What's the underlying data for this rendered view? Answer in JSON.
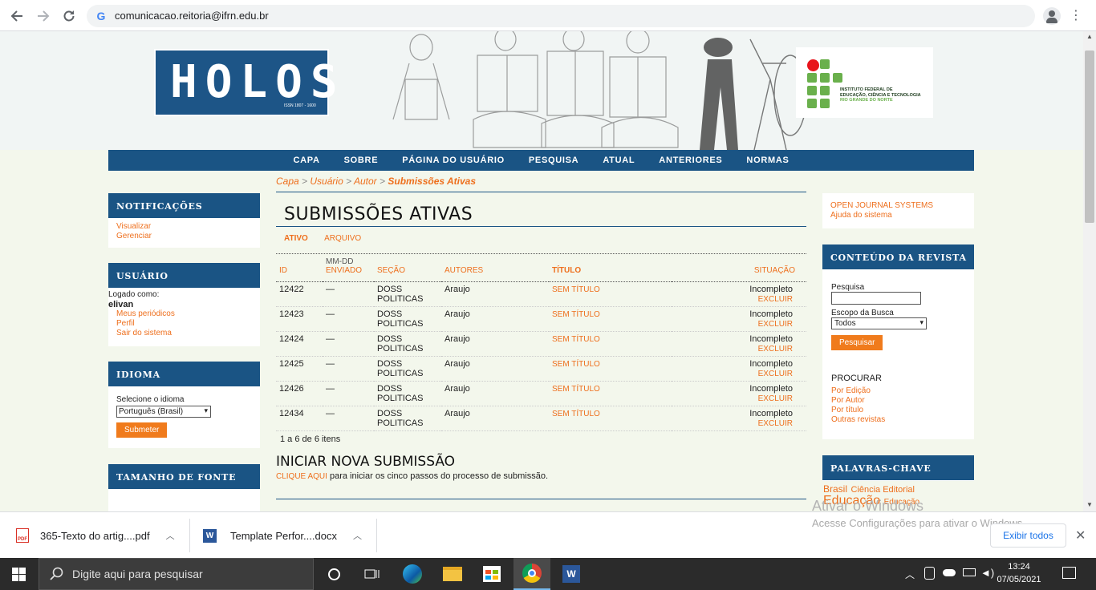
{
  "browser": {
    "url": "comunicacao.reitoria@ifrn.edu.br"
  },
  "header": {
    "logo_text": "HOLOS",
    "issn": "ISSN 1807 - 1600",
    "ifrn_line1": "INSTITUTO FEDERAL DE",
    "ifrn_line2": "EDUCAÇÃO, CIÊNCIA E TECNOLOGIA",
    "ifrn_line3": "RIO GRANDE DO NORTE"
  },
  "nav": [
    "CAPA",
    "SOBRE",
    "PÁGINA DO USUÁRIO",
    "PESQUISA",
    "ATUAL",
    "ANTERIORES",
    "NORMAS"
  ],
  "left_sidebar": {
    "notifications": {
      "title": "NOTIFICAÇÕES",
      "links": [
        "Visualizar",
        "Gerenciar"
      ]
    },
    "user": {
      "title": "USUÁRIO",
      "logged_as": "Logado como:",
      "username": "elivan",
      "links": [
        "Meus periódicos",
        "Perfil",
        "Sair do sistema"
      ]
    },
    "language": {
      "title": "IDIOMA",
      "label": "Selecione o idioma",
      "selected": "Português (Brasil)",
      "submit": "Submeter"
    },
    "font_size": {
      "title": "TAMANHO DE FONTE"
    }
  },
  "breadcrumb": {
    "items": [
      "Capa",
      "Usuário",
      "Autor"
    ],
    "sep": ">",
    "current": "Submissões Ativas"
  },
  "main": {
    "title": "SUBMISSÕES ATIVAS",
    "tabs": [
      "ATIVO",
      "ARQUIVO"
    ],
    "columns": {
      "id": "ID",
      "date_top": "MM-DD",
      "date_bottom": "ENVIADO",
      "section": "SEÇÃO",
      "authors": "AUTORES",
      "title": "TÍTULO",
      "status": "SITUAÇÃO"
    },
    "rows": [
      {
        "id": "12422",
        "date": "—",
        "section": "DOSS POLITICAS",
        "authors": "Araujo",
        "title": "SEM TÍTULO",
        "status": "Incompleto",
        "action": "EXCLUIR"
      },
      {
        "id": "12423",
        "date": "—",
        "section": "DOSS POLITICAS",
        "authors": "Araujo",
        "title": "SEM TÍTULO",
        "status": "Incompleto",
        "action": "EXCLUIR"
      },
      {
        "id": "12424",
        "date": "—",
        "section": "DOSS POLITICAS",
        "authors": "Araujo",
        "title": "SEM TÍTULO",
        "status": "Incompleto",
        "action": "EXCLUIR"
      },
      {
        "id": "12425",
        "date": "—",
        "section": "DOSS POLITICAS",
        "authors": "Araujo",
        "title": "SEM TÍTULO",
        "status": "Incompleto",
        "action": "EXCLUIR"
      },
      {
        "id": "12426",
        "date": "—",
        "section": "DOSS POLITICAS",
        "authors": "Araujo",
        "title": "SEM TÍTULO",
        "status": "Incompleto",
        "action": "EXCLUIR"
      },
      {
        "id": "12434",
        "date": "—",
        "section": "DOSS POLITICAS",
        "authors": "Araujo",
        "title": "SEM TÍTULO",
        "status": "Incompleto",
        "action": "EXCLUIR"
      }
    ],
    "pagination": "1 a 6 de 6 itens",
    "new_title": "INICIAR NOVA SUBMISSÃO",
    "new_link": "CLIQUE AQUI",
    "new_text": " para iniciar os cinco passos do processo de submissão."
  },
  "right_sidebar": {
    "ojs_links": [
      "OPEN JOURNAL SYSTEMS",
      "Ajuda do sistema"
    ],
    "content": {
      "title": "CONTEÚDO DA REVISTA",
      "search_label": "Pesquisa",
      "scope_label": "Escopo da Busca",
      "scope_value": "Todos",
      "search_btn": "Pesquisar",
      "browse_title": "PROCURAR",
      "browse_links": [
        "Por Edição",
        "Por Autor",
        "Por título",
        "Outras revistas"
      ]
    },
    "keywords": {
      "title": "PALAVRAS-CHAVE",
      "k1": "Brasil",
      "k2": "Ciência Editorial",
      "k3": "Educação",
      "k4": "Educação"
    }
  },
  "downloads": {
    "items": [
      {
        "name": "365-Texto do artig....pdf",
        "type": "PDF"
      },
      {
        "name": "Template Perfor....docx",
        "type": "W"
      }
    ],
    "show_all": "Exibir todos",
    "activate_title": "Ativar o Windows",
    "activate_text": "Acesse Configurações para ativar o Windows."
  },
  "taskbar": {
    "search_placeholder": "Digite aqui para pesquisar",
    "time": "13:24",
    "date": "07/05/2021"
  },
  "colors": {
    "navy": "#1a5484",
    "orange": "#ee6f1d",
    "page_bg": "#f3f7ec"
  }
}
